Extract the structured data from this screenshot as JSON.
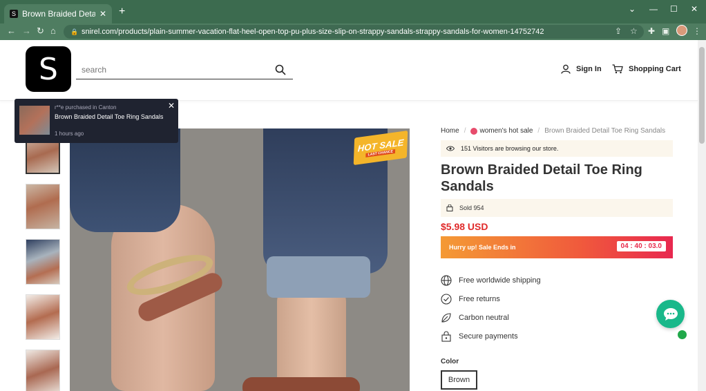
{
  "browser": {
    "tab_title": "Brown Braided Detail Toe Ring S",
    "tab_favicon": "S",
    "tab_close": "✕",
    "new_tab": "+",
    "url": "snirel.com/products/plain-summer-vacation-flat-heel-open-top-pu-plus-size-slip-on-strappy-sandals-strappy-sandals-for-women-14752742",
    "window_controls": [
      "⌄",
      "—",
      "☐",
      "✕"
    ]
  },
  "header": {
    "logo_letter": "S",
    "search_placeholder": "search",
    "sign_in": "Sign In",
    "cart": "Shopping Cart"
  },
  "toast": {
    "line1": "r**e purchased in Canton",
    "product": "Brown Braided Detail Toe Ring Sandals",
    "time": "1 hours ago",
    "close": "✕"
  },
  "badge": {
    "hot_sale": "HOT SALE",
    "sub": "LAST CHANCE"
  },
  "breadcrumb": {
    "home": "Home",
    "category": "women's hot sale",
    "current": "Brown Braided Detail Toe Ring Sandals"
  },
  "product": {
    "visitors": "151 Visitors are browsing our store.",
    "title": "Brown Braided Detail Toe Ring Sandals",
    "sold": "Sold 954",
    "price": "$5.98 USD",
    "sale_text": "Hurry up! Sale Ends in",
    "timer": "04 : 40 : 03.0",
    "features": [
      "Free worldwide shipping",
      "Free returns",
      "Carbon neutral",
      "Secure payments"
    ],
    "color_label": "Color",
    "color_value": "Brown"
  },
  "colors": {
    "price_red": "#e02a2a",
    "chat_green": "#19b88a",
    "chrome_green": "#3c6b4f"
  }
}
